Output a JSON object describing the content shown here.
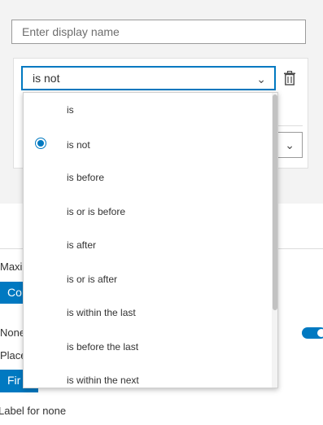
{
  "display_name": {
    "placeholder": "Enter display name",
    "value": ""
  },
  "condition": {
    "selected_operator": "is not",
    "delete_icon": "trash-icon",
    "chevron_icon": "chevron-down-icon"
  },
  "dropdown": {
    "options": [
      {
        "label": "is",
        "selected": false
      },
      {
        "label": "is not",
        "selected": true
      },
      {
        "label": "is before",
        "selected": false
      },
      {
        "label": "is or is before",
        "selected": false
      },
      {
        "label": "is after",
        "selected": false
      },
      {
        "label": "is or is after",
        "selected": false
      },
      {
        "label": "is within the last",
        "selected": false
      },
      {
        "label": "is before the last",
        "selected": false
      },
      {
        "label": "is within the next",
        "selected": false
      }
    ]
  },
  "background": {
    "maximum_label": "Maxi",
    "maximum_button": "Co",
    "none_label": "None",
    "placement_label": "Place",
    "placement_button": "Fir",
    "label_for_none": "Label for none",
    "toggle_on": true
  },
  "colors": {
    "accent": "#0079c1",
    "panel_bg": "#f3f3f3"
  }
}
